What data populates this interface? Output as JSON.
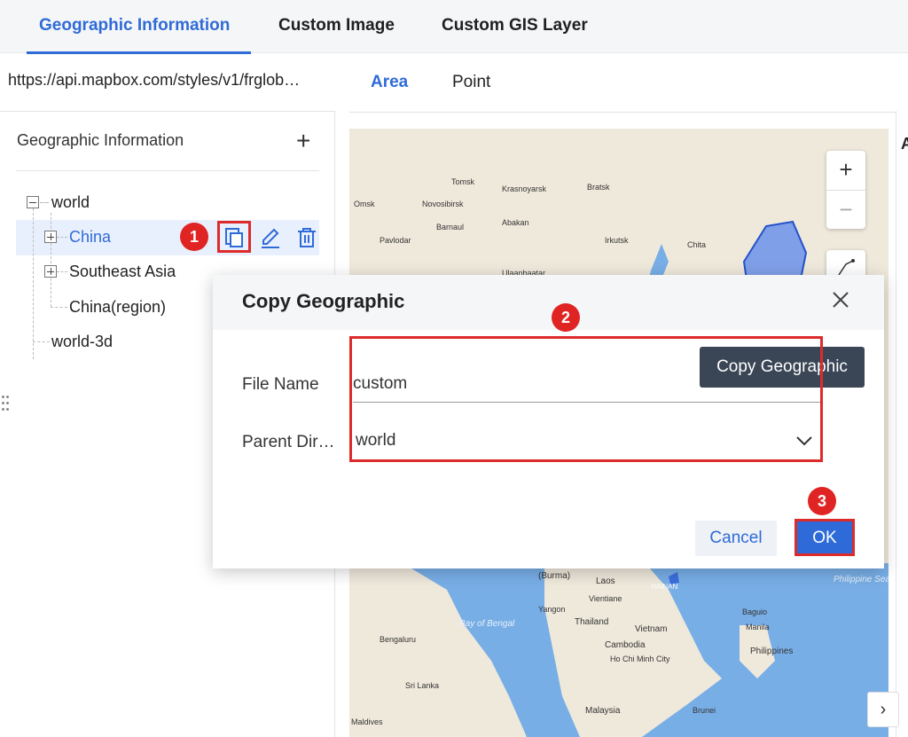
{
  "top_tabs": [
    {
      "label": "Geographic Information",
      "active": true
    },
    {
      "label": "Custom Image",
      "active": false
    },
    {
      "label": "Custom GIS Layer",
      "active": false
    }
  ],
  "left_panel": {
    "url": "https://api.mapbox.com/styles/v1/frglob…",
    "title": "Geographic Information",
    "add_icon": "plus-icon",
    "tree": [
      {
        "label": "world",
        "expanded": true
      },
      {
        "label": "China",
        "selected": true
      },
      {
        "label": "Southeast Asia"
      },
      {
        "label": "China(region)"
      },
      {
        "label": "world-3d"
      }
    ],
    "row_actions": [
      "copy-icon",
      "edit-icon",
      "delete-icon"
    ]
  },
  "sub_tabs": [
    {
      "label": "Area",
      "active": true
    },
    {
      "label": "Point",
      "active": false
    }
  ],
  "map": {
    "labels": [
      "Tomsk",
      "Krasnoyarsk",
      "Bratsk",
      "Omsk",
      "Novosibirsk",
      "Barnaul",
      "Abakan",
      "Pavlodar",
      "Irkutsk",
      "Chita",
      "Ulaanbaatar",
      "(Burma)",
      "Laos",
      "Vientiane",
      "Yangon",
      "Thailand",
      "Vietnam",
      "Cambodia",
      "Ho Chi Minh City",
      "Manila",
      "Philippines",
      "Baguio",
      "Sri Lanka",
      "Malaysia",
      "Brunei",
      "Bengaluru",
      "Maldives",
      "Bay of Bengal",
      "Philippine Sea",
      "HAINAN"
    ],
    "zoom_in": "+",
    "zoom_out": "−",
    "water_color": "#78aee6",
    "land_color": "#efe9dc",
    "highlight_color": "#3d6fe0"
  },
  "dialog": {
    "title": "Copy Geographic",
    "close_icon": "close-icon",
    "file_name_label": "File Name",
    "file_name_value": "custom",
    "parent_dir_label": "Parent Dir…",
    "parent_dir_value": "world",
    "tooltip": "Copy Geographic",
    "cancel_label": "Cancel",
    "ok_label": "OK"
  },
  "steps": [
    "1",
    "2",
    "3"
  ],
  "right_edge_letter": "A"
}
